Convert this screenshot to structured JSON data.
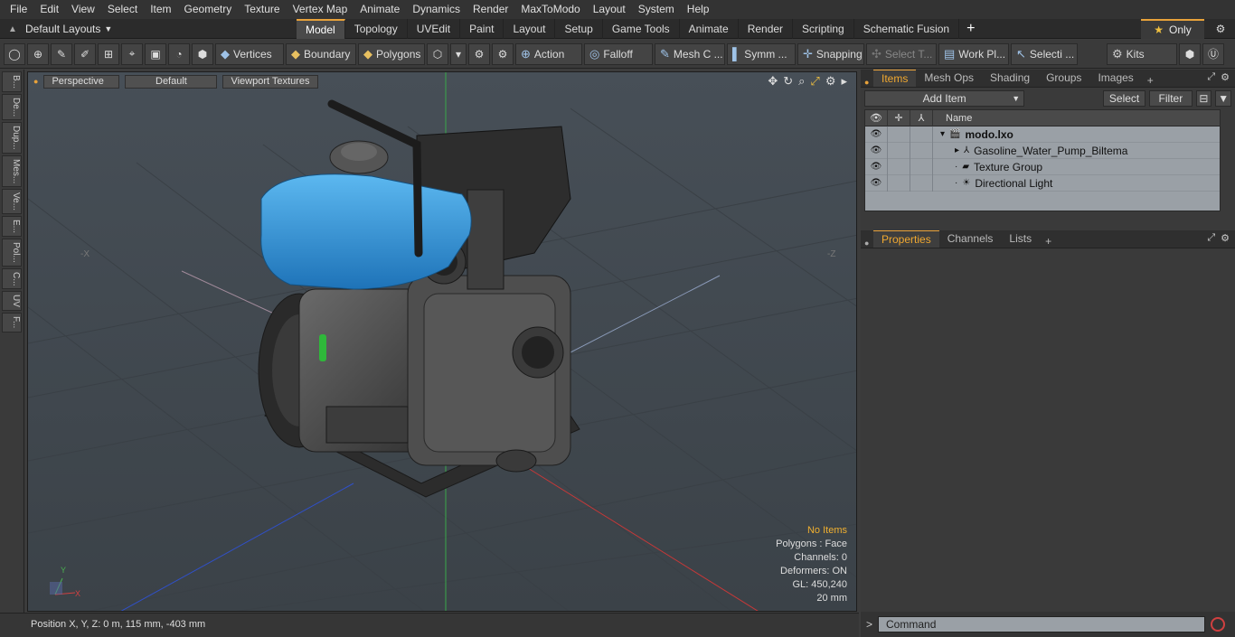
{
  "menu": [
    "File",
    "Edit",
    "View",
    "Select",
    "Item",
    "Geometry",
    "Texture",
    "Vertex Map",
    "Animate",
    "Dynamics",
    "Render",
    "MaxToModo",
    "Layout",
    "System",
    "Help"
  ],
  "layout_selector": "Default Layouts",
  "tabs": [
    "Model",
    "Topology",
    "UVEdit",
    "Paint",
    "Layout",
    "Setup",
    "Game Tools",
    "Animate",
    "Render",
    "Scripting",
    "Schematic Fusion"
  ],
  "active_tab": "Model",
  "only_label": "Only",
  "toolbar": {
    "vertices": "Vertices",
    "boundary": "Boundary",
    "polygons": "Polygons",
    "action": "Action",
    "falloff": "Falloff",
    "mesh_c": "Mesh C ...",
    "symm": "Symm ...",
    "snapping": "Snapping",
    "select_t": "Select T...",
    "work_pl": "Work Pl...",
    "selecti": "Selecti ...",
    "kits": "Kits"
  },
  "left_tabs": [
    "B...",
    "De...",
    "Dup...",
    "Mes...",
    "Ve...",
    "E...",
    "Pol...",
    "C...",
    "UV",
    "F..."
  ],
  "viewport": {
    "view_mode": "Perspective",
    "shading": "Default",
    "textures": "Viewport Textures",
    "info": {
      "selection": "No Items",
      "polygons": "Polygons : Face",
      "channels": "Channels: 0",
      "deformers": "Deformers: ON",
      "gl": "GL: 450,240",
      "scale": "20 mm"
    },
    "axis_labels": {
      "x_neg": "-X",
      "z_neg": "-Z"
    }
  },
  "status": "Position X, Y, Z:   0 m, 115 mm, -403 mm",
  "items_panel": {
    "tabs": [
      "Items",
      "Mesh Ops",
      "Shading",
      "Groups",
      "Images"
    ],
    "active": "Items",
    "add_item": "Add Item",
    "select": "Select",
    "filter": "Filter",
    "column_name": "Name",
    "tree": [
      {
        "label": "modo.lxo",
        "level": 0,
        "bold": true,
        "icon": "scene-icon"
      },
      {
        "label": "Gasoline_Water_Pump_Biltema",
        "level": 1,
        "bold": false,
        "icon": "mesh-icon"
      },
      {
        "label": "Texture Group",
        "level": 1,
        "bold": false,
        "icon": "texture-icon"
      },
      {
        "label": "Directional Light",
        "level": 1,
        "bold": false,
        "icon": "light-icon"
      }
    ]
  },
  "props_panel": {
    "tabs": [
      "Properties",
      "Channels",
      "Lists"
    ],
    "active": "Properties"
  },
  "command": {
    "placeholder": "Command"
  }
}
